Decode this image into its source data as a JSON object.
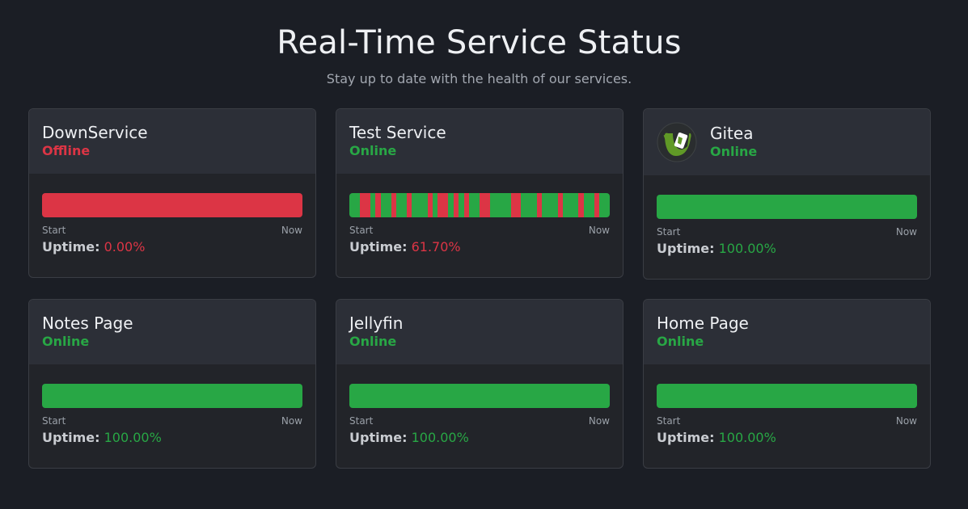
{
  "header": {
    "title": "Real-Time Service Status",
    "subtitle": "Stay up to date with the health of our services."
  },
  "labels": {
    "start": "Start",
    "now": "Now",
    "uptime": "Uptime:"
  },
  "colors": {
    "online": "#28a745",
    "offline": "#dc3545",
    "background": "#1b1e25",
    "card": "#222429",
    "card_header": "#2c2f37"
  },
  "services": [
    {
      "name": "DownService",
      "status": "Offline",
      "uptime": "0.00%",
      "uptime_fraction": 0.0,
      "history": [
        0,
        0,
        0,
        0,
        0,
        0,
        0,
        0,
        0,
        0,
        0,
        0,
        0,
        0,
        0,
        0,
        0,
        0,
        0,
        0,
        0,
        0,
        0,
        0,
        0,
        0,
        0,
        0,
        0,
        0,
        0,
        0,
        0,
        0,
        0,
        0,
        0,
        0,
        0,
        0,
        0,
        0,
        0,
        0,
        0,
        0,
        0,
        0,
        0,
        0
      ]
    },
    {
      "name": "Test Service",
      "status": "Online",
      "uptime": "61.70%",
      "uptime_fraction": 0.617,
      "history": [
        1,
        1,
        0,
        0,
        1,
        0,
        1,
        1,
        0,
        1,
        1,
        0,
        1,
        1,
        1,
        0,
        1,
        0,
        0,
        1,
        0,
        1,
        0,
        1,
        1,
        0,
        0,
        1,
        1,
        1,
        1,
        0,
        0,
        1,
        1,
        1,
        0,
        1,
        1,
        1,
        0,
        1,
        1,
        1,
        0,
        1,
        1,
        0,
        1,
        1
      ]
    },
    {
      "name": "Gitea",
      "status": "Online",
      "uptime": "100.00%",
      "uptime_fraction": 1.0,
      "logo": "gitea-logo-icon",
      "history": [
        1,
        1,
        1,
        1,
        1,
        1,
        1,
        1,
        1,
        1,
        1,
        1,
        1,
        1,
        1,
        1,
        1,
        1,
        1,
        1,
        1,
        1,
        1,
        1,
        1,
        1,
        1,
        1,
        1,
        1,
        1,
        1,
        1,
        1,
        1,
        1,
        1,
        1,
        1,
        1,
        1,
        1,
        1,
        1,
        1,
        1,
        1,
        1,
        1,
        1
      ]
    },
    {
      "name": "Notes Page",
      "status": "Online",
      "uptime": "100.00%",
      "uptime_fraction": 1.0,
      "history": [
        1,
        1,
        1,
        1,
        1,
        1,
        1,
        1,
        1,
        1,
        1,
        1,
        1,
        1,
        1,
        1,
        1,
        1,
        1,
        1,
        1,
        1,
        1,
        1,
        1,
        1,
        1,
        1,
        1,
        1,
        1,
        1,
        1,
        1,
        1,
        1,
        1,
        1,
        1,
        1,
        1,
        1,
        1,
        1,
        1,
        1,
        1,
        1,
        1,
        1
      ]
    },
    {
      "name": "Jellyfin",
      "status": "Online",
      "uptime": "100.00%",
      "uptime_fraction": 1.0,
      "history": [
        1,
        1,
        1,
        1,
        1,
        1,
        1,
        1,
        1,
        1,
        1,
        1,
        1,
        1,
        1,
        1,
        1,
        1,
        1,
        1,
        1,
        1,
        1,
        1,
        1,
        1,
        1,
        1,
        1,
        1,
        1,
        1,
        1,
        1,
        1,
        1,
        1,
        1,
        1,
        1,
        1,
        1,
        1,
        1,
        1,
        1,
        1,
        1,
        1,
        1
      ]
    },
    {
      "name": "Home Page",
      "status": "Online",
      "uptime": "100.00%",
      "uptime_fraction": 1.0,
      "history": [
        1,
        1,
        1,
        1,
        1,
        1,
        1,
        1,
        1,
        1,
        1,
        1,
        1,
        1,
        1,
        1,
        1,
        1,
        1,
        1,
        1,
        1,
        1,
        1,
        1,
        1,
        1,
        1,
        1,
        1,
        1,
        1,
        1,
        1,
        1,
        1,
        1,
        1,
        1,
        1,
        1,
        1,
        1,
        1,
        1,
        1,
        1,
        1,
        1,
        1
      ]
    }
  ]
}
